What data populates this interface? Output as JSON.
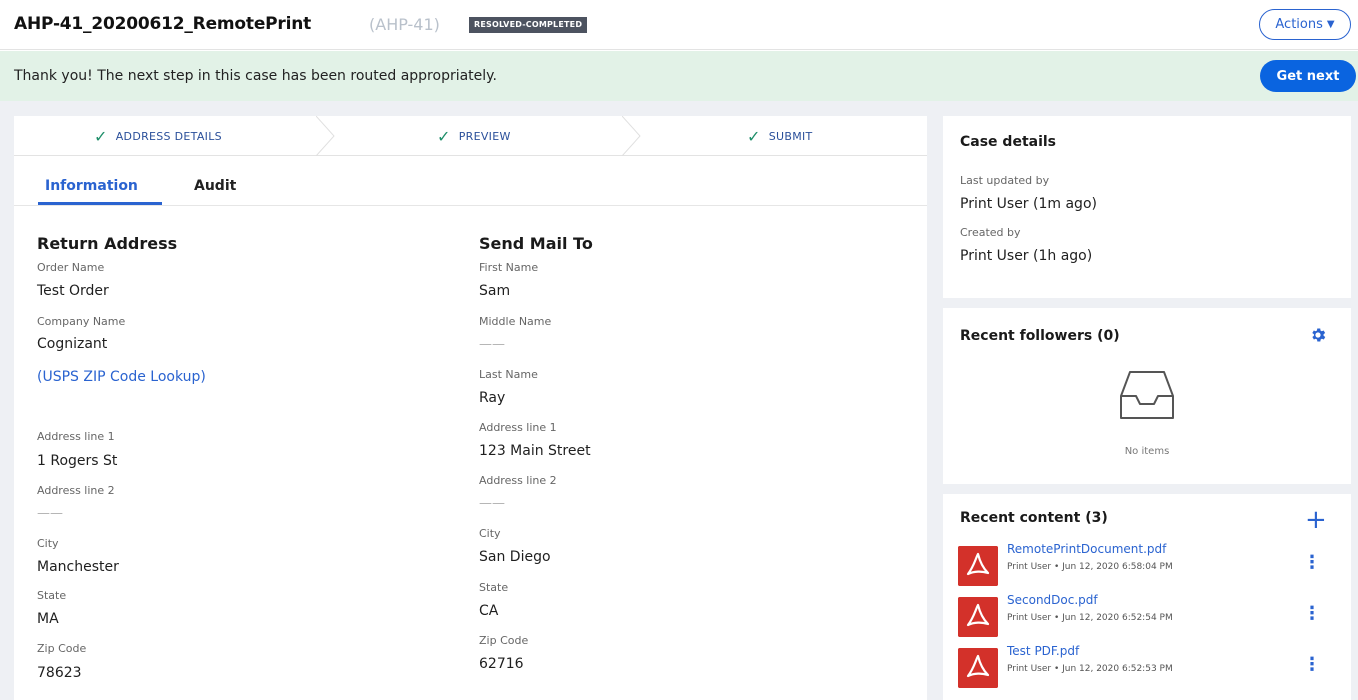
{
  "header": {
    "title": "AHP-41_20200612_RemotePrint",
    "case_id": "(AHP-41)",
    "status": "RESOLVED-COMPLETED",
    "actions_label": "Actions"
  },
  "banner": {
    "message": "Thank you! The next step in this case has been routed appropriately.",
    "get_next_label": "Get next"
  },
  "stepper": {
    "steps": [
      "ADDRESS DETAILS",
      "PREVIEW",
      "SUBMIT"
    ]
  },
  "tabs": [
    "Information",
    "Audit"
  ],
  "return_address": {
    "title": "Return Address",
    "order_name_label": "Order Name",
    "order_name": "Test Order",
    "company_name_label": "Company Name",
    "company_name": "Cognizant",
    "zip_lookup_link": "(USPS ZIP Code Lookup)",
    "address1_label": "Address line 1",
    "address1": "1 Rogers St",
    "address2_label": "Address line 2",
    "address2": "——",
    "city_label": "City",
    "city": "Manchester",
    "state_label": "State",
    "state": "MA",
    "zip_label": "Zip Code",
    "zip": "78623"
  },
  "send_mail_to": {
    "title": "Send Mail To",
    "first_name_label": "First Name",
    "first_name": "Sam",
    "middle_name_label": "Middle Name",
    "middle_name": "——",
    "last_name_label": "Last Name",
    "last_name": "Ray",
    "address1_label": "Address line 1",
    "address1": "123 Main Street",
    "address2_label": "Address line 2",
    "address2": "——",
    "city_label": "City",
    "city": "San Diego",
    "state_label": "State",
    "state": "CA",
    "zip_label": "Zip Code",
    "zip": "62716"
  },
  "case_details": {
    "title": "Case details",
    "last_updated_label": "Last updated by",
    "last_updated_value": "Print User (1m ago)",
    "created_label": "Created by",
    "created_value": "Print User (1h ago)"
  },
  "followers": {
    "title": "Recent followers (0)",
    "empty_text": "No items"
  },
  "recent_content": {
    "title": "Recent content (3)",
    "files": [
      {
        "name": "RemotePrintDocument.pdf",
        "meta": "Print User  •  Jun 12, 2020 6:58:04 PM"
      },
      {
        "name": "SecondDoc.pdf",
        "meta": "Print User  •  Jun 12, 2020 6:52:54 PM"
      },
      {
        "name": "Test PDF.pdf",
        "meta": "Print User  •  Jun 12, 2020 6:52:53 PM"
      }
    ]
  },
  "colors": {
    "accent": "#2a63d0",
    "banner_bg": "#e2f2e7",
    "pdf_red": "#d3312a",
    "badge_bg": "#4d5360"
  },
  "icons": [
    "check-icon",
    "chevron-down-icon",
    "gear-icon",
    "inbox-icon",
    "plus-icon",
    "pdf-icon",
    "kebab-icon"
  ]
}
